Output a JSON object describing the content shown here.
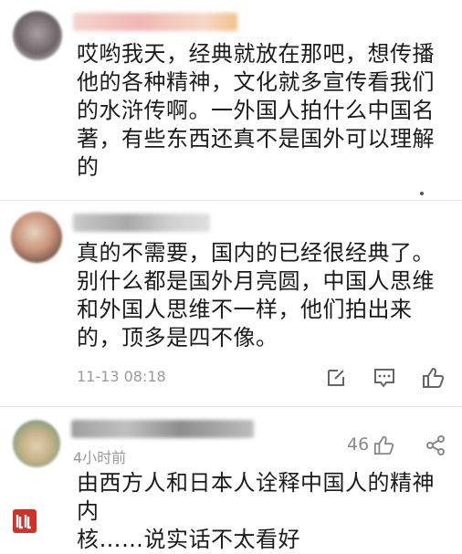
{
  "comments": [
    {
      "text": "哎哟我天，经典就放在那吧，想传播\n他的各种精神，文化就多宣传看我们\n的水浒传啊。一外国人拍什么中国名\n著，有些东西还真不是国外可以理解\n的"
    },
    {
      "text": "真的不需要，国内的已经很经典了。\n别什么都是国外月亮圆，中国人思维\n和外国人思维不一样，他们拍出来\n的，顶多是四不像。",
      "time": "11-13 08:18"
    },
    {
      "text": "由西方人和日本人诠释中国人的精神内\n核……说实话不太看好",
      "time": "4小时前",
      "likes": "46"
    }
  ],
  "icons": [
    "edit-icon",
    "comment-icon",
    "thumb-up-icon",
    "thumb-up-icon",
    "share-icon",
    "logo-icon"
  ],
  "colors": {
    "logo_red": "#d0322a",
    "meta_gray": "#9a9a9a"
  }
}
